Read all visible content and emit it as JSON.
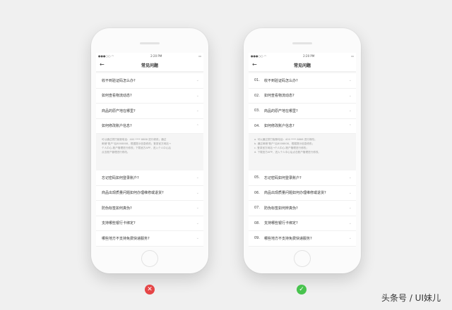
{
  "status": {
    "time": "2:20 PM"
  },
  "nav": {
    "back_icon": "←",
    "title": "常见问题"
  },
  "left": {
    "items_top": [
      "收不到验证码怎么办?",
      "如何查看物流动态?",
      "商品的原产地在哪里?",
      "如何修改账户信息?"
    ],
    "answer": [
      "可以通过拨打客服电话：400 **** 8888 进行修改；通过",
      "邮储\"账户\"后8008808，根据提示信息修改；登录官方网站→",
      "个人中心-账户管理进行修改；下载官方APP，进入个人中心后",
      "点击账户管理进行修改。"
    ],
    "items_bottom": [
      "忘记密码如何登录账户?",
      "商品出现质量问题如何办理维修或退货?",
      "防伪标签如何真伪?",
      "支持哪些银行卡绑定?",
      "哪些地方不支持免费快递服务?"
    ]
  },
  "right": {
    "items_top": [
      {
        "num": "01.",
        "q": "收不到验证码怎么办?"
      },
      {
        "num": "02.",
        "q": "如何查看物流动态?"
      },
      {
        "num": "03.",
        "q": "商品的原产地在哪里?"
      },
      {
        "num": "04.",
        "q": "如何修改账户信息?"
      }
    ],
    "answer": [
      "a. 可以通过拨打客服电话：400 **** 8888 进行修改；",
      "b. 通过邮储\"账户\"后8008808，根据提示信息修改；",
      "c. 登录官方网站→个人中心-账户管理进行修改；",
      "d. 下载官方APP，进入个人中心后点击账户管理进行修改。"
    ],
    "items_bottom": [
      {
        "num": "05.",
        "q": "忘记密码如何登录账户?"
      },
      {
        "num": "06.",
        "q": "商品出现质量问题如何办理维修或退货?"
      },
      {
        "num": "07.",
        "q": "防伪标签如何辨真伪?"
      },
      {
        "num": "08.",
        "q": "支持哪些银行卡绑定?"
      },
      {
        "num": "09.",
        "q": "哪些地方不支持免费快递服务?"
      }
    ]
  },
  "badges": {
    "wrong": "✕",
    "right": "✓"
  },
  "watermark": "头条号 / UI妹儿",
  "colors": {
    "wrong": "#e54546",
    "right": "#48c34e"
  },
  "icons": {
    "chevron": "⌄"
  }
}
